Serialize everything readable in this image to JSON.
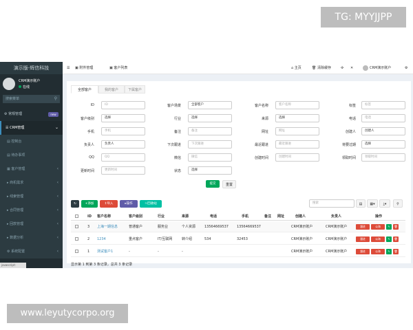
{
  "watermarks": {
    "top_right": "TG: MYYJJPP",
    "bottom_left": "www.leyutycorpo.org"
  },
  "sidebar": {
    "logo": "演示版-辉信科技",
    "user": {
      "name": "CRM演示账户",
      "status": "在线"
    },
    "search_placeholder": "搜索菜单",
    "items": [
      {
        "label": "常规管理",
        "badge": "new",
        "icon": "gear-icon"
      },
      {
        "label": "CRM管理",
        "icon": "list-icon",
        "active": true
      },
      {
        "label": "控制台",
        "sub": true
      },
      {
        "label": "待办事项",
        "sub": true
      },
      {
        "label": "客户管理",
        "sub": true
      },
      {
        "label": "商机需求",
        "sub": true
      },
      {
        "label": "线索管理",
        "sub": true
      },
      {
        "label": "合同管理",
        "sub": true
      },
      {
        "label": "回款管理",
        "sub": true
      },
      {
        "label": "数据分析",
        "sub": true
      },
      {
        "label": "系统配置",
        "sub": true
      }
    ],
    "status_url": "javascript:"
  },
  "topbar": {
    "tabs": [
      "附件管理",
      "客户列表"
    ],
    "home": "主页",
    "clear_cache": "清除缓存",
    "user": "CRM演示账户"
  },
  "tabs": [
    "全部客户",
    "我的客户",
    "下属客户"
  ],
  "form": {
    "rows": [
      [
        {
          "label": "ID",
          "type": "input",
          "placeholder": "ID"
        },
        {
          "label": "客户场景",
          "type": "select",
          "value": "全部客户"
        },
        {
          "label": "客户名称",
          "type": "input",
          "placeholder": "客户名称"
        },
        {
          "label": "标签",
          "type": "input",
          "placeholder": "标签"
        }
      ],
      [
        {
          "label": "客户级别",
          "type": "select",
          "value": "选择"
        },
        {
          "label": "行业",
          "type": "select",
          "value": "选择"
        },
        {
          "label": "来源",
          "type": "select",
          "value": "选择"
        },
        {
          "label": "电话",
          "type": "input",
          "placeholder": "电话"
        }
      ],
      [
        {
          "label": "手机",
          "type": "input",
          "placeholder": "手机"
        },
        {
          "label": "备注",
          "type": "input",
          "placeholder": "备注"
        },
        {
          "label": "网址",
          "type": "input",
          "placeholder": "网址"
        },
        {
          "label": "创建人",
          "type": "select",
          "value": "创建人"
        }
      ],
      [
        {
          "label": "负责人",
          "type": "select",
          "value": "负责人"
        },
        {
          "label": "下次跟进",
          "type": "input",
          "placeholder": "下次跟进"
        },
        {
          "label": "最近跟进",
          "type": "input",
          "placeholder": "最近跟进"
        },
        {
          "label": "将要过期",
          "type": "select",
          "value": "选择"
        }
      ],
      [
        {
          "label": "QQ",
          "type": "input",
          "placeholder": "QQ"
        },
        {
          "label": "微信",
          "type": "input",
          "placeholder": "微信"
        },
        {
          "label": "创建时间",
          "type": "input",
          "placeholder": "创建时间"
        },
        {
          "label": "领取时间",
          "type": "input",
          "placeholder": "领取时间"
        }
      ],
      [
        {
          "label": "更新时间",
          "type": "input",
          "placeholder": "更新时间"
        },
        {
          "label": "状态",
          "type": "select",
          "value": "选择"
        }
      ]
    ],
    "submit": "提交",
    "reset": "重置"
  },
  "toolbar": {
    "add": "添加",
    "import": "导入",
    "operate": "操作",
    "receive": "回收站",
    "search_placeholder": "搜索"
  },
  "table": {
    "headers": [
      "ID",
      "客户名称",
      "客户级别",
      "行业",
      "来源",
      "电话",
      "手机",
      "备注",
      "网址",
      "创建人",
      "负责人",
      "操作"
    ],
    "rows": [
      {
        "id": "3",
        "name": "上海一期信息",
        "level": "普通客户",
        "industry": "服务业",
        "source": "个人资源",
        "phone": "13564669537",
        "mobile": "13564669537",
        "note": "",
        "url": "",
        "creator": "CRM演示账户",
        "owner": "CRM演示账户"
      },
      {
        "id": "2",
        "name": "1234",
        "level": "重点客户",
        "industry": "IT/互联网",
        "source": "转介绍",
        "phone": "534",
        "mobile": "32453",
        "note": "",
        "url": "",
        "creator": "CRM演示账户",
        "owner": "CRM演示账户"
      },
      {
        "id": "1",
        "name": "测试客户1",
        "level": "-",
        "industry": "-",
        "source": "-",
        "phone": "",
        "mobile": "",
        "note": "",
        "url": "",
        "creator": "CRM演示账户",
        "owner": "CRM演示账户"
      }
    ],
    "row_actions": [
      "跟进",
      "公海",
      "编辑",
      "删除"
    ]
  },
  "footer": "显示第 1 到第 3 条记录，总共 3 条记录",
  "colors": {
    "sidebar": "#222d32",
    "accent": "#3c8dbc",
    "green": "#00a65a",
    "red": "#dd4b39",
    "purple": "#605ca8",
    "teal": "#00c0a3"
  }
}
